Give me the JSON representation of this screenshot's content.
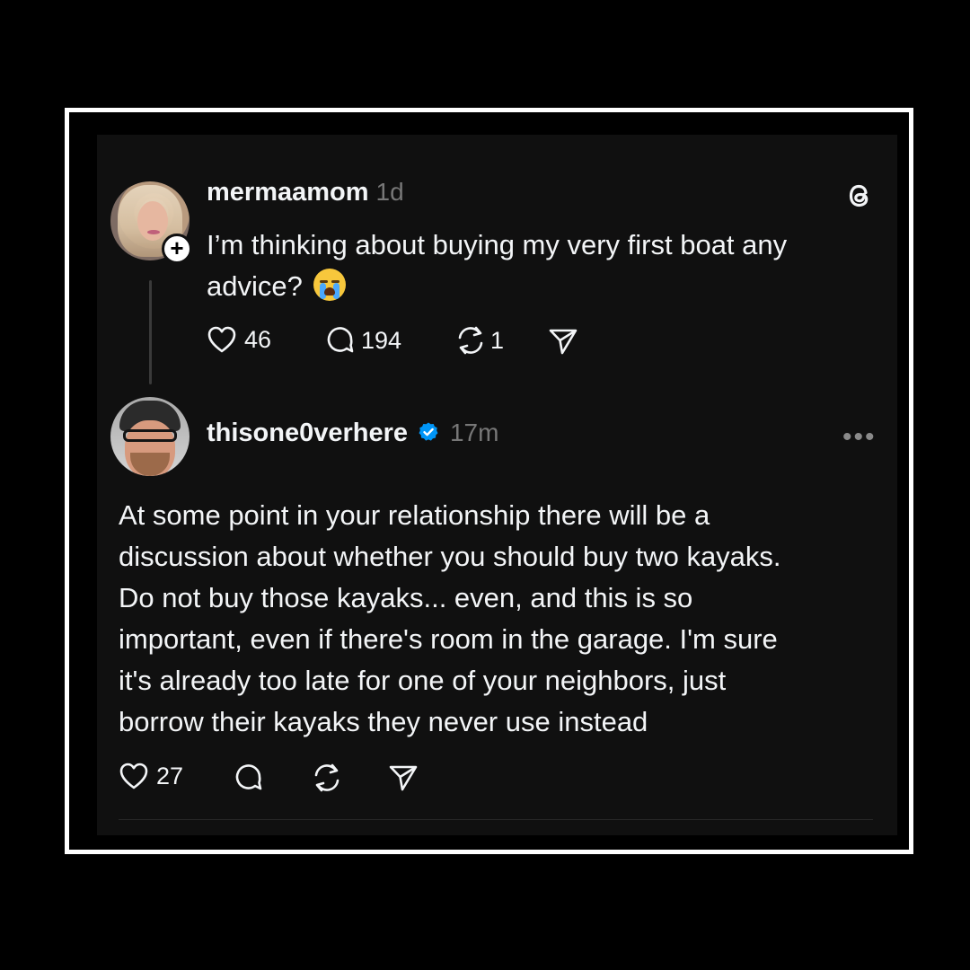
{
  "post": {
    "username": "mermaamom",
    "time": "1d",
    "text": "I’m thinking about buying my very first boat any advice?",
    "emoji": "loudly-crying-face",
    "likes": "46",
    "comments": "194",
    "reposts": "1"
  },
  "reply": {
    "username": "thisone0verhere",
    "verified": true,
    "time": "17m",
    "text_lines": [
      "At some point in your relationship there will be a",
      "discussion about whether you should buy two kayaks.",
      "Do not buy those kayaks... even, and this is so",
      "important, even if there's room in the garage. I'm sure",
      "it's already too late for one of your neighbors, just",
      "borrow their kayaks they never use instead"
    ],
    "likes": "27"
  },
  "icons": {
    "threads_logo": "threads-logo-icon",
    "more": "more-options-icon",
    "like": "heart-icon",
    "comment": "comment-icon",
    "repost": "repost-icon",
    "share": "share-icon",
    "verified": "verified-badge-icon"
  },
  "colors": {
    "background": "#000000",
    "card": "#101010",
    "text": "#f3f5f7",
    "muted": "#777777",
    "verified": "#0095f6",
    "frame": "#ffffff"
  }
}
